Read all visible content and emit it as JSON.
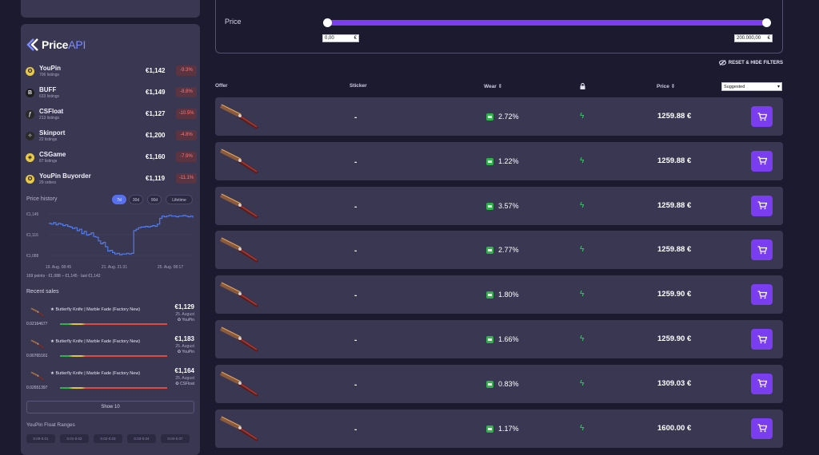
{
  "logo": {
    "brand": "Price",
    "suffix": "API"
  },
  "markets": [
    {
      "name": "YouPin",
      "sub": "706 listings",
      "price": "€1,142",
      "change": "-9.3%",
      "icon_color": "#e8c94a",
      "icon": "youpin-icon"
    },
    {
      "name": "BUFF",
      "sub": "633 listings",
      "price": "€1,149",
      "change": "-8.8%",
      "icon_color": "#1d1d1d",
      "icon": "buff-icon"
    },
    {
      "name": "CSFloat",
      "sub": "213 listings",
      "price": "€1,127",
      "change": "-10.5%",
      "icon_color": "#2a2a2a",
      "icon": "csfloat-icon"
    },
    {
      "name": "Skinport",
      "sub": "22 listings",
      "price": "€1,200",
      "change": "-4.8%",
      "icon_color": "#2a2a2a",
      "icon": "skinport-icon"
    },
    {
      "name": "CSGame",
      "sub": "87 listings",
      "price": "€1,160",
      "change": "-7.9%",
      "icon_color": "#e8c94a",
      "icon": "csgame-icon"
    },
    {
      "name": "YouPin Buyorder",
      "sub": "29 orders",
      "price": "€1,119",
      "change": "-11.1%",
      "icon_color": "#e8c94a",
      "icon": "youpin-buyorder-icon"
    }
  ],
  "price_history": {
    "title": "Price history",
    "ranges": [
      "7d",
      "30d",
      "90d",
      "Lifetime"
    ],
    "active_range": "7d",
    "points_text": "169 points · €1,088 – €1,145 · last €1,142"
  },
  "chart_data": {
    "type": "line",
    "title": "",
    "ylim": [
      1088,
      1145
    ],
    "y_ticks": [
      "€1,145",
      "€1,116",
      "€1,088"
    ],
    "x_ticks": [
      "19. Aug. 08:45",
      "21. Aug. 21:31",
      "25. Aug. 08:17"
    ],
    "series": [
      {
        "values": [
          1132,
          1131,
          1133,
          1130,
          1132,
          1131,
          1129,
          1130,
          1128,
          1127,
          1125,
          1126,
          1122,
          1124,
          1118,
          1121,
          1116,
          1117,
          1119,
          1114,
          1113,
          1108,
          1104,
          1106,
          1100,
          1094,
          1095,
          1092,
          1090,
          1091,
          1089,
          1090,
          1090,
          1091,
          1090,
          1091,
          1122,
          1124,
          1126,
          1127,
          1127,
          1128,
          1127,
          1128,
          1129,
          1128,
          1131,
          1139,
          1142,
          1141,
          1142,
          1143,
          1142,
          1142,
          1141,
          1142,
          1142,
          1143,
          1142,
          1141,
          1142,
          1140
        ]
      }
    ]
  },
  "recent_sales": {
    "title": "Recent sales",
    "items": [
      {
        "name": "★ Butterfly Knife | Marble Fade (Factory New)",
        "price": "€1,129",
        "date": "25. August",
        "market": "YouPin",
        "float": "0.02164677"
      },
      {
        "name": "★ Butterfly Knife | Marble Fade (Factory New)",
        "price": "€1,183",
        "date": "25. August",
        "market": "YouPin",
        "float": "0.00765161"
      },
      {
        "name": "★ Butterfly Knife | Marble Fade (Factory New)",
        "price": "€1,164",
        "date": "25. August",
        "market": "CSFloat",
        "float": "0.02651397"
      }
    ],
    "show_button": "Show 10"
  },
  "float_ranges": {
    "title": "YouPin Float Ranges",
    "items": [
      "0.00-0.01",
      "0.01-0.02",
      "0.02-0.03",
      "0.03-0.04",
      "0.04-0.07"
    ]
  },
  "filters": {
    "price_label": "Price",
    "min": "0,00",
    "max": "200.000,00",
    "currency": "€",
    "min_fraction": 0.0,
    "max_fraction": 1.0,
    "reset_label": "RESET & HIDE FILTERS"
  },
  "table": {
    "headers": {
      "offer": "Offer",
      "sticker": "Sticker",
      "wear": "Wear ⇕",
      "price": "Price ⇕"
    },
    "sort": "Suggested",
    "rows": [
      {
        "sticker": "-",
        "wear": "2.72%",
        "price": "1259.88 €"
      },
      {
        "sticker": "-",
        "wear": "1.22%",
        "price": "1259.88 €"
      },
      {
        "sticker": "-",
        "wear": "3.57%",
        "price": "1259.88 €"
      },
      {
        "sticker": "-",
        "wear": "2.77%",
        "price": "1259.88 €"
      },
      {
        "sticker": "-",
        "wear": "1.80%",
        "price": "1259.90 €"
      },
      {
        "sticker": "-",
        "wear": "1.66%",
        "price": "1259.90 €"
      },
      {
        "sticker": "-",
        "wear": "0.83%",
        "price": "1309.03 €"
      },
      {
        "sticker": "-",
        "wear": "1.17%",
        "price": "1600.00 €"
      }
    ]
  },
  "colors": {
    "accent": "#7b3df0",
    "panel": "#3a3752",
    "background": "#1c1a2e",
    "chart_line": "#4f7cf0",
    "loss": "#ff7676",
    "bolt": "#39d86a"
  }
}
